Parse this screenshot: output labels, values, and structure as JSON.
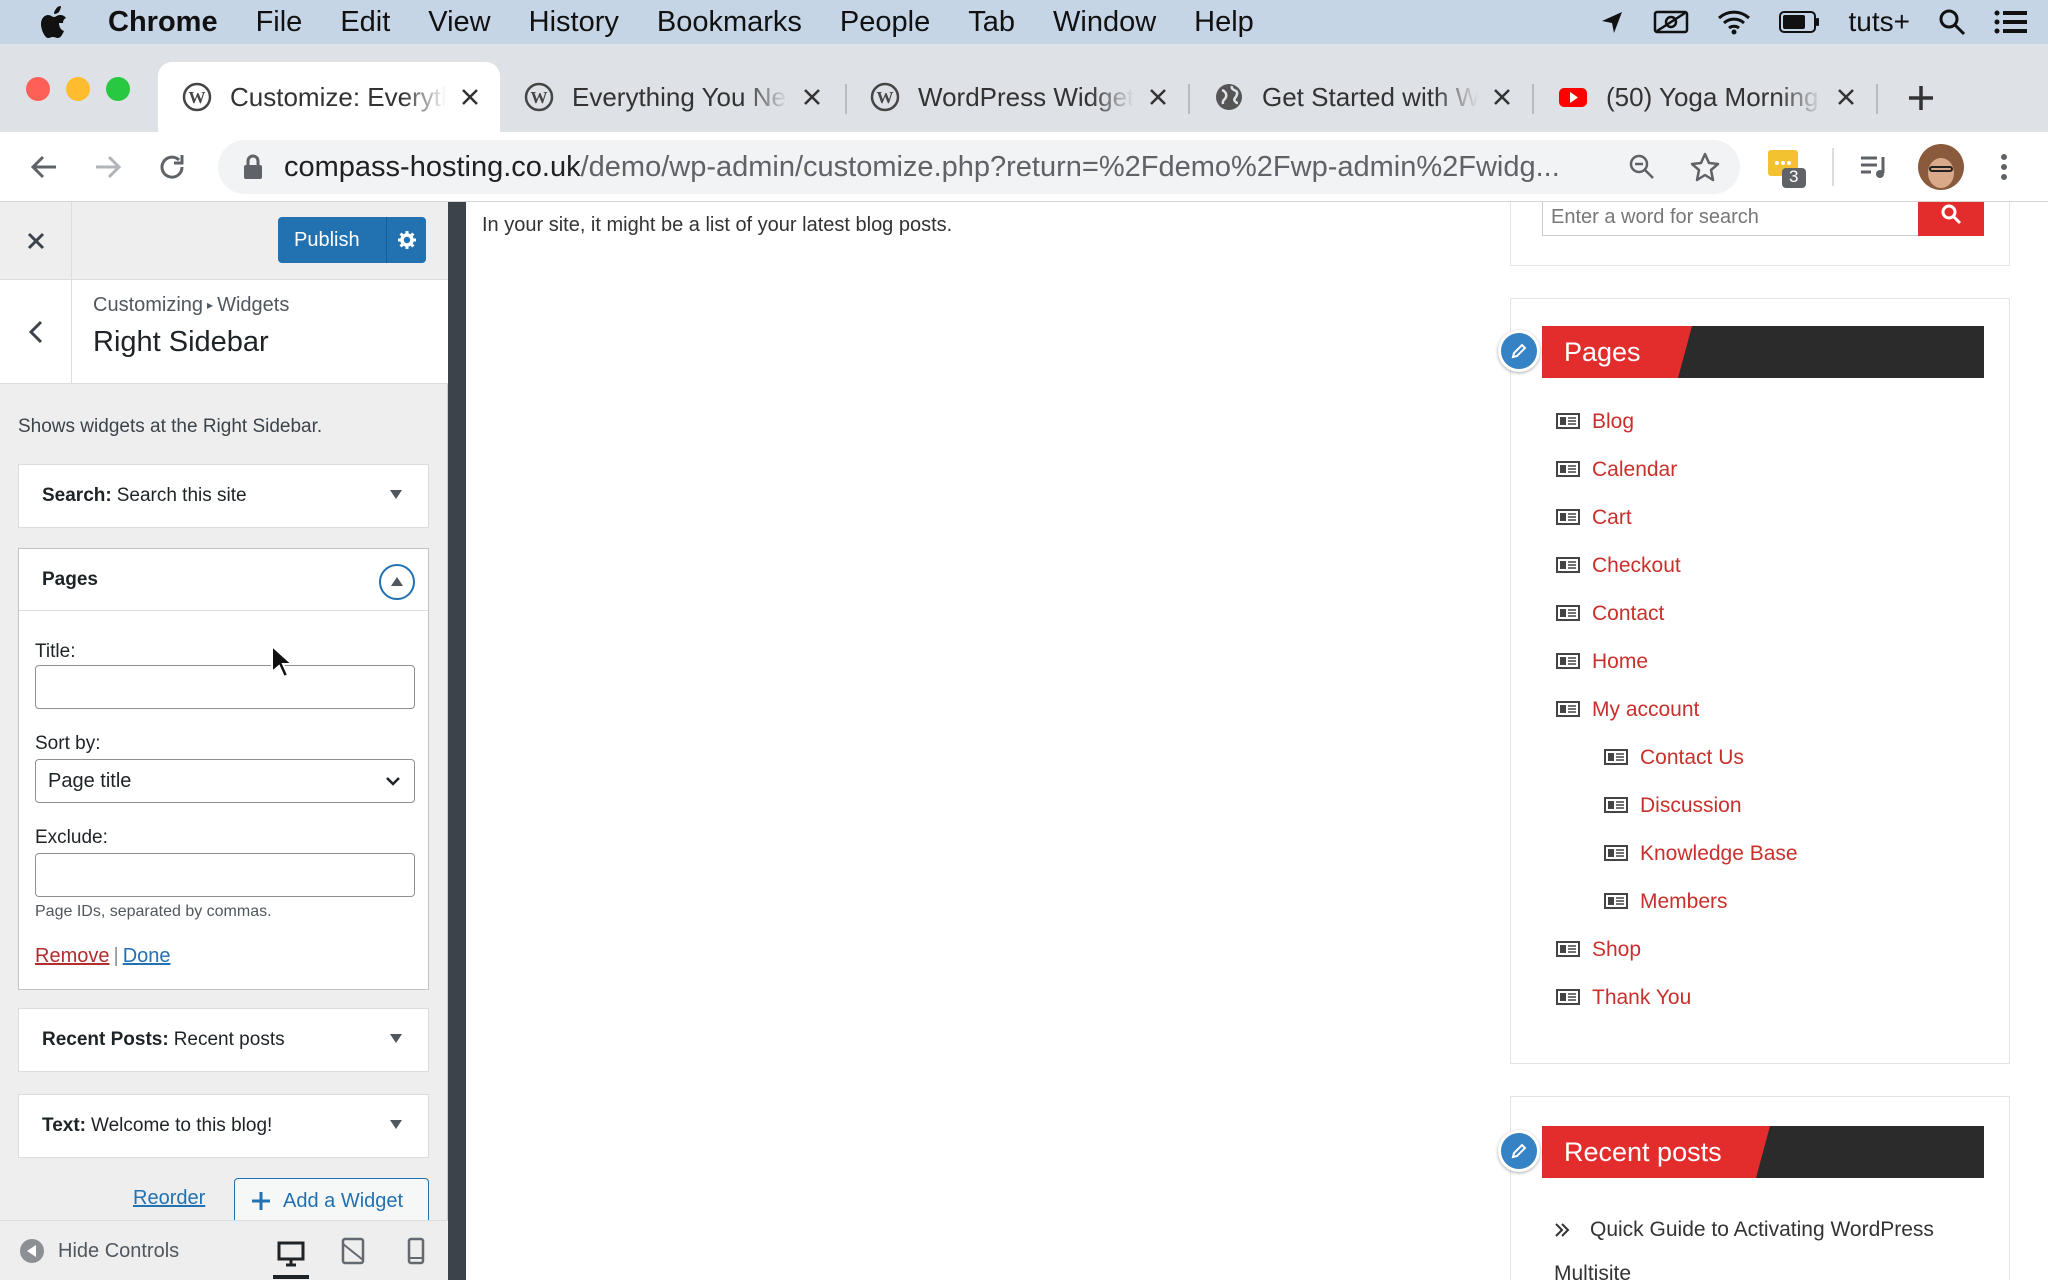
{
  "menubar": {
    "app": "Chrome",
    "items": [
      "File",
      "Edit",
      "View",
      "History",
      "Bookmarks",
      "People",
      "Tab",
      "Window",
      "Help"
    ],
    "status_text": "tuts+"
  },
  "tabs": [
    {
      "title": "Customize: Everything",
      "favicon": "wordpress-icon",
      "active": true
    },
    {
      "title": "Everything You Need",
      "favicon": "wordpress-icon",
      "active": false
    },
    {
      "title": "WordPress Widgets",
      "favicon": "wordpress-icon",
      "active": false
    },
    {
      "title": "Get Started with WordPress",
      "favicon": "globe-icon",
      "active": false
    },
    {
      "title": "(50) Yoga Morning",
      "favicon": "youtube-icon",
      "active": false
    }
  ],
  "toolbar": {
    "url_host": "compass-hosting.co.uk",
    "url_path": "/demo/wp-admin/customize.php?return=%2Fdemo%2Fwp-admin%2Fwidg...",
    "extension_badge": "3"
  },
  "customizer": {
    "publish_label": "Publish",
    "breadcrumb_parent": "Customizing",
    "breadcrumb_child": "Widgets",
    "section_title": "Right Sidebar",
    "description": "Shows widgets at the Right Sidebar.",
    "widgets": {
      "search": {
        "type": "Search",
        "title": "Search this site"
      },
      "pages": {
        "type": "Pages",
        "title_label": "Title:",
        "title_value": "",
        "sortby_label": "Sort by:",
        "sortby_value": "Page title",
        "exclude_label": "Exclude:",
        "exclude_value": "",
        "exclude_hint": "Page IDs, separated by commas.",
        "remove_label": "Remove",
        "separator": "|",
        "done_label": "Done"
      },
      "recent_posts": {
        "type": "Recent Posts",
        "title": "Recent posts"
      },
      "text": {
        "type": "Text",
        "title": "Welcome to this blog!"
      }
    },
    "reorder_label": "Reorder",
    "add_widget_label": "Add a Widget",
    "hide_controls_label": "Hide Controls"
  },
  "preview": {
    "intro_text": "In your site, it might be a list of your latest blog posts.",
    "search_placeholder": "Enter a word for search",
    "pages_title": "Pages",
    "pages": [
      "Blog",
      "Calendar",
      "Cart",
      "Checkout",
      "Contact",
      "Home",
      "My account"
    ],
    "subpages": [
      "Contact Us",
      "Discussion",
      "Knowledge Base",
      "Members"
    ],
    "pages_after": [
      "Shop",
      "Thank You"
    ],
    "recent_title": "Recent posts",
    "recent_item_line1": "Quick Guide to Activating WordPress",
    "recent_item_line2": "Multisite"
  },
  "colors": {
    "wp_blue": "#2271b1",
    "theme_red": "#e32d2d",
    "link_red": "#c9302c",
    "dark_bar": "#2b2b2b"
  }
}
